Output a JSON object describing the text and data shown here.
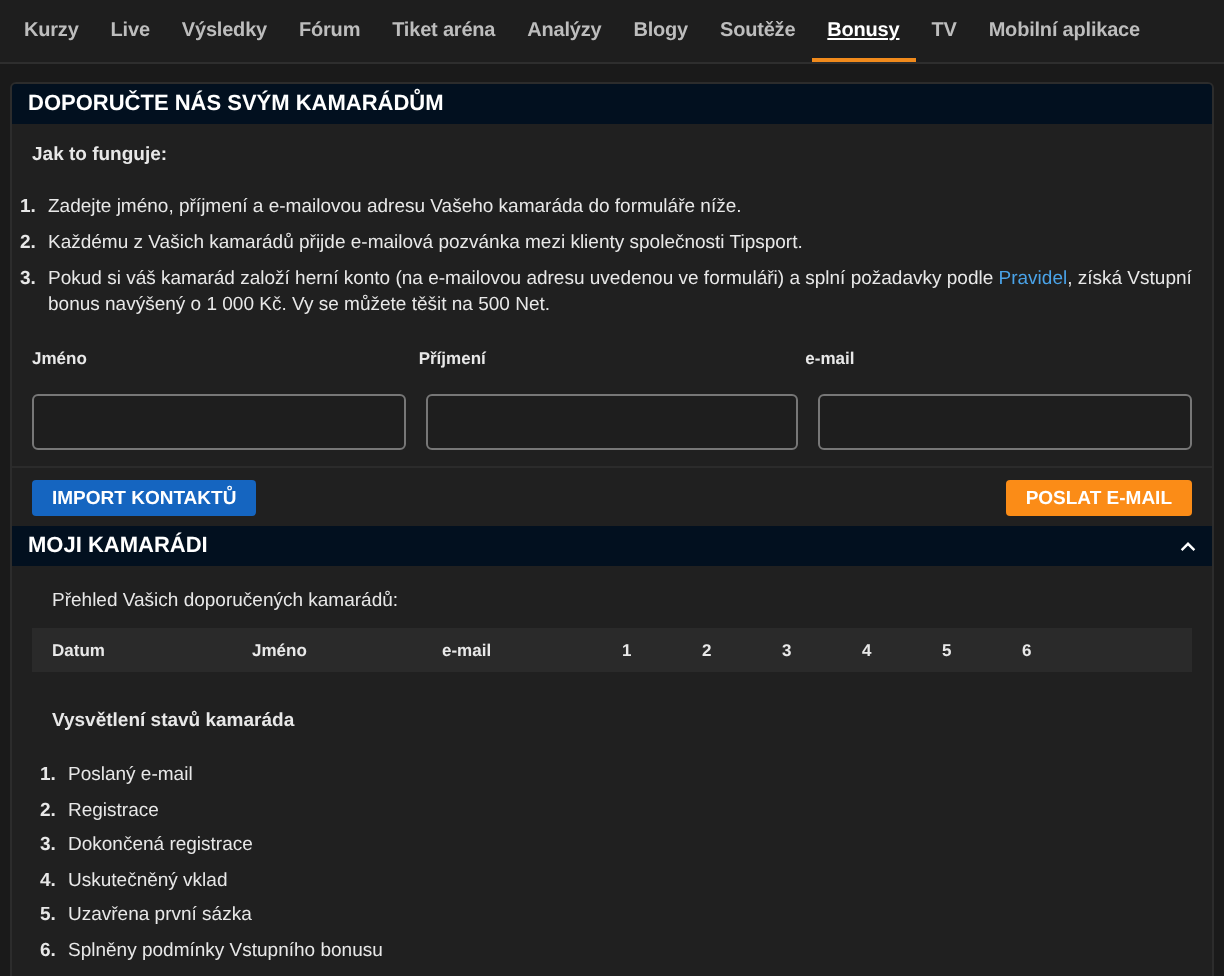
{
  "nav": [
    {
      "label": "Kurzy",
      "selected": false
    },
    {
      "label": "Live",
      "selected": false
    },
    {
      "label": "Výsledky",
      "selected": false
    },
    {
      "label": "Fórum",
      "selected": false
    },
    {
      "label": "Tiket aréna",
      "selected": false
    },
    {
      "label": "Analýzy",
      "selected": false
    },
    {
      "label": "Blogy",
      "selected": false
    },
    {
      "label": "Soutěže",
      "selected": false
    },
    {
      "label": "Bonusy",
      "selected": true
    },
    {
      "label": "TV",
      "selected": false
    },
    {
      "label": "Mobilní aplikace",
      "selected": false
    }
  ],
  "refer": {
    "title": "DOPORUČTE NÁS SVÝM KAMARÁDŮM",
    "subtitle": "Jak to funguje:",
    "steps": [
      {
        "number": "1.",
        "text": "Zadejte jméno, příjmení a e-mailovou adresu Vašeho kamaráda do formuláře níže."
      },
      {
        "number": "2.",
        "text": "Každému z Vašich kamarádů přijde e-mailová pozvánka mezi klienty společnosti Tipsport."
      },
      {
        "number": "3.",
        "text": "Pokud si váš kamarád založí herní konto (na e-mailovou adresu uvedenou ve formuláři) a splní požadavky podle ",
        "link": "Pravidel",
        "text_after": ", získá Vstupní bonus navýšený o 1 000 Kč. Vy se můžete těšit na 500 Net."
      }
    ],
    "fields": [
      {
        "label": "Jméno"
      },
      {
        "label": "Příjmení"
      },
      {
        "label": "e-mail"
      }
    ],
    "import_button": "IMPORT KONTAKTŮ",
    "send_button": "POSLAT E-MAIL"
  },
  "friends": {
    "title": "MOJI KAMARÁDI",
    "expanded": true,
    "overview": "Přehled Vašich doporučených kamarádů:",
    "columns": [
      "Datum",
      "Jméno",
      "e-mail",
      "1",
      "2",
      "3",
      "4",
      "5",
      "6"
    ],
    "legend_title": "Vysvětlení stavů kamaráda",
    "legend": [
      {
        "number": "1.",
        "text": "Poslaný e-mail"
      },
      {
        "number": "2.",
        "text": "Registrace"
      },
      {
        "number": "3.",
        "text": "Dokončená registrace"
      },
      {
        "number": "4.",
        "text": "Uskutečněný vklad"
      },
      {
        "number": "5.",
        "text": "Uzavřena první sázka"
      },
      {
        "number": "6.",
        "text": "Splněny podmínky Vstupního bonusu"
      }
    ]
  }
}
